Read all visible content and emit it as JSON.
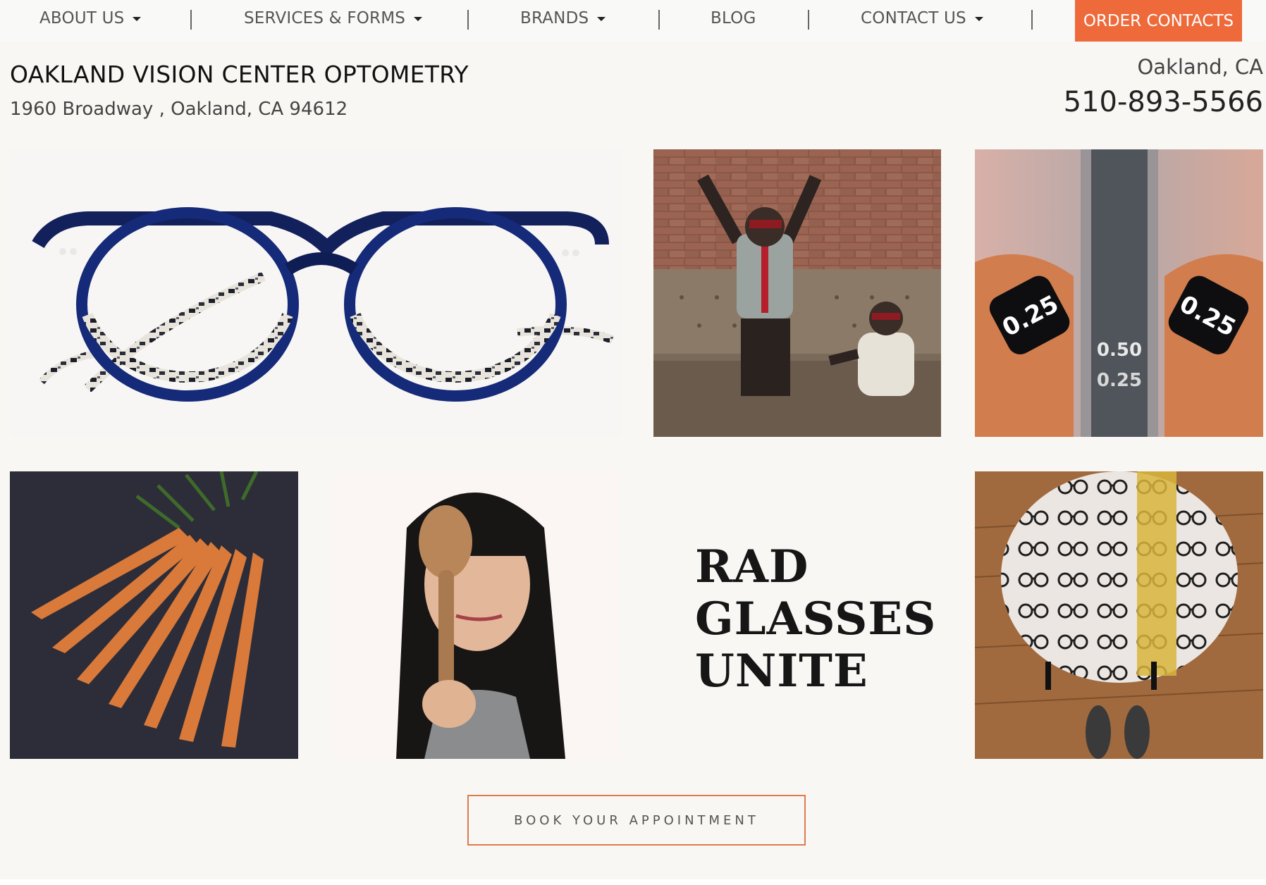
{
  "nav": {
    "items": [
      {
        "label": "ABOUT US",
        "dropdown": true
      },
      {
        "label": "SERVICES & FORMS",
        "dropdown": true
      },
      {
        "label": "BRANDS",
        "dropdown": true
      },
      {
        "label": "BLOG",
        "dropdown": false
      },
      {
        "label": "CONTACT US",
        "dropdown": true
      }
    ],
    "cta_label": "ORDER CONTACTS",
    "cta_color": "#ee6a3a"
  },
  "header": {
    "business_name": "OAKLAND VISION CENTER OPTOMETRY",
    "address": "1960 Broadway , Oakland, CA 94612",
    "city": "Oakland, CA",
    "phone": "510-893-5566"
  },
  "gallery": {
    "tiles": [
      {
        "name": "blue-tortoise-glasses-photo"
      },
      {
        "name": "chimps-3d-glasses-photo"
      },
      {
        "name": "phoropter-lenses-photo",
        "lens_labels": [
          "0.25",
          "0.25"
        ],
        "chart_labels": [
          "0.50",
          "0.25"
        ]
      },
      {
        "name": "carrots-photo"
      },
      {
        "name": "woman-wooden-spoon-photo"
      },
      {
        "name": "rad-glasses-unite-text-tile"
      },
      {
        "name": "glasses-print-stool-photo"
      }
    ],
    "tagline_lines": [
      "RAD",
      "GLASSES",
      "UNITE"
    ]
  },
  "cta": {
    "book_label": "BOOK YOUR APPOINTMENT",
    "accent": "#e07a4e"
  }
}
